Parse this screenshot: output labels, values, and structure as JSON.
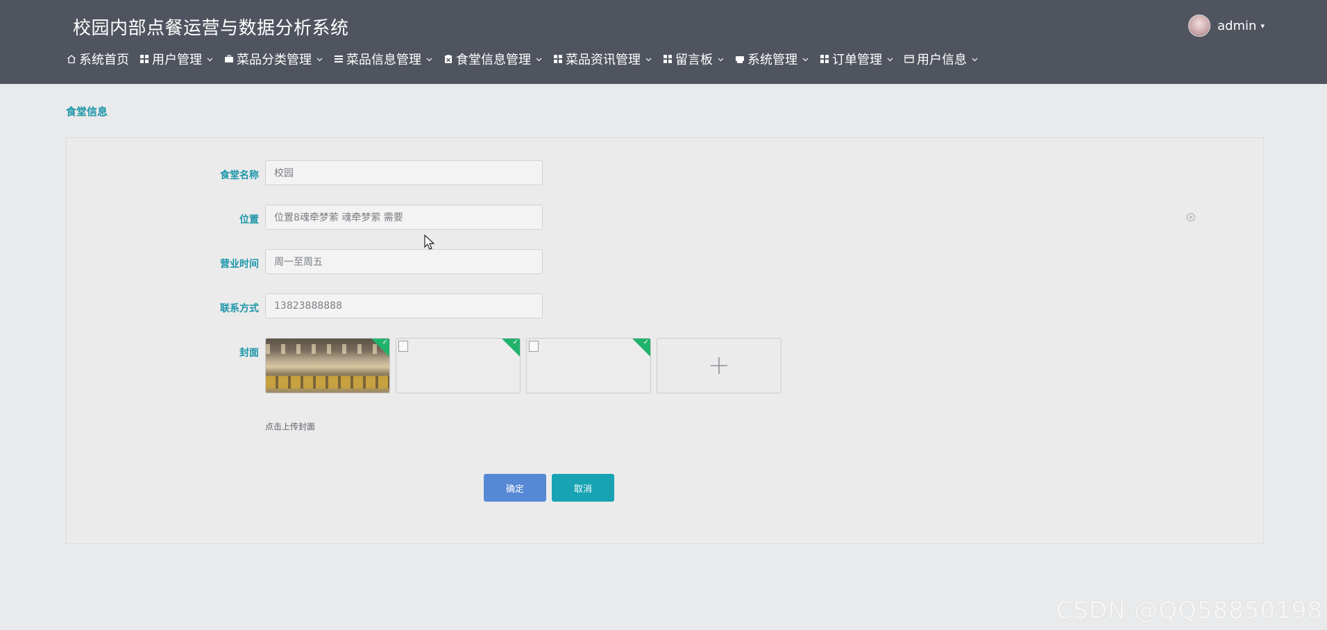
{
  "header": {
    "app_title": "校园内部点餐运营与数据分析系统",
    "user_name": "admin",
    "caret": "▾"
  },
  "nav": [
    {
      "label": "系统首页",
      "icon": "home-icon",
      "has_dropdown": false
    },
    {
      "label": "用户管理",
      "icon": "grid-icon",
      "has_dropdown": true
    },
    {
      "label": "菜品分类管理",
      "icon": "briefcase-icon",
      "has_dropdown": true
    },
    {
      "label": "菜品信息管理",
      "icon": "list-icon",
      "has_dropdown": true
    },
    {
      "label": "食堂信息管理",
      "icon": "clipboard-icon",
      "has_dropdown": true
    },
    {
      "label": "菜品资讯管理",
      "icon": "grid-icon",
      "has_dropdown": true
    },
    {
      "label": "留言板",
      "icon": "grid-icon",
      "has_dropdown": true
    },
    {
      "label": "系统管理",
      "icon": "printer-icon",
      "has_dropdown": true
    },
    {
      "label": "订单管理",
      "icon": "grid-icon",
      "has_dropdown": true
    },
    {
      "label": "用户信息",
      "icon": "card-icon",
      "has_dropdown": true
    }
  ],
  "breadcrumb": "食堂信息",
  "form": {
    "name_label": "食堂名称",
    "name_value": "校园",
    "location_label": "位置",
    "location_value": "位置8魂牵梦萦 魂牵梦萦 需要",
    "hours_label": "营业时间",
    "hours_value": "周一至周五",
    "contact_label": "联系方式",
    "contact_value": "13823888888",
    "cover_label": "封面",
    "upload_hint": "点击上传封面",
    "upload_plus": "+"
  },
  "buttons": {
    "confirm": "确定",
    "cancel": "取消"
  },
  "watermark": "CSDN @QQ58850198",
  "colors": {
    "topbar": "#50545f",
    "accent_teal": "#1c96a8",
    "confirm_button": "#5688d5",
    "cancel_button": "#17a3b4",
    "upload_success_corner": "#21b26b"
  }
}
